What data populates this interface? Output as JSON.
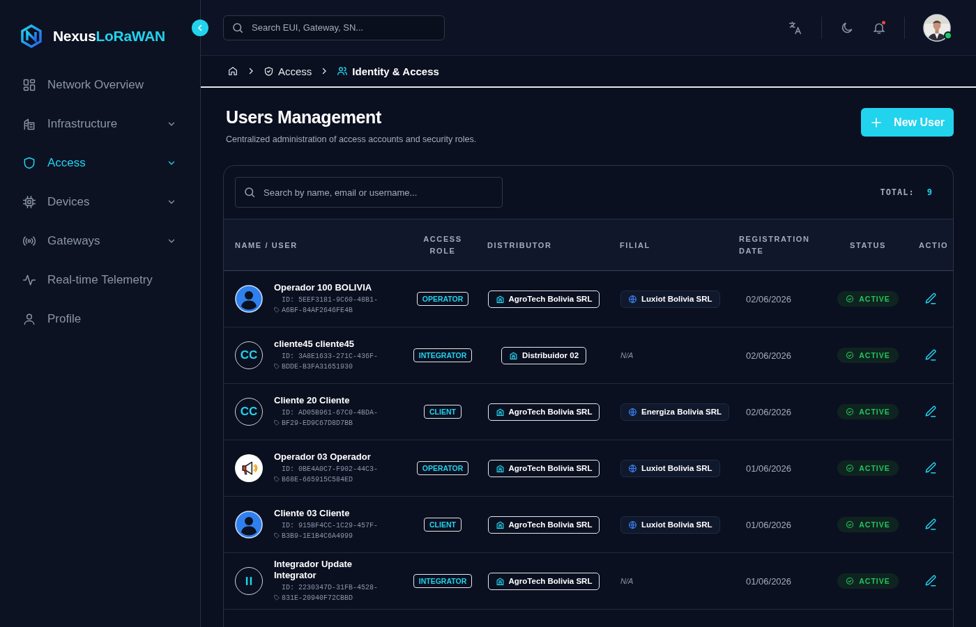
{
  "brand": {
    "name": "Nexus",
    "accent": "LoRaWAN"
  },
  "sidebar": {
    "items": [
      {
        "label": "Network Overview",
        "expandable": false,
        "selected": false
      },
      {
        "label": "Infrastructure",
        "expandable": true,
        "selected": false
      },
      {
        "label": "Access",
        "expandable": true,
        "selected": true
      },
      {
        "label": "Devices",
        "expandable": true,
        "selected": false
      },
      {
        "label": "Gateways",
        "expandable": true,
        "selected": false
      },
      {
        "label": "Real-time Telemetry",
        "expandable": false,
        "selected": false
      },
      {
        "label": "Profile",
        "expandable": false,
        "selected": false
      }
    ]
  },
  "topbar": {
    "search": {
      "placeholder": "Search EUI, Gateway, SN..."
    },
    "notifications_unread": true,
    "user_online": true
  },
  "breadcrumb": [
    {
      "label": "Access",
      "current": false
    },
    {
      "label": "Identity & Access",
      "current": true
    }
  ],
  "page": {
    "title": "Users Management",
    "subtitle": "Centralized administration of access accounts and security roles.",
    "new_button": "New User"
  },
  "table": {
    "search": {
      "placeholder": "Search by name, email or username..."
    },
    "total_label": "TOTAL:",
    "total": "9",
    "columns": [
      "NAME / USER",
      "ACCESS ROLE",
      "DISTRIBUTOR",
      "FILIAL",
      "REGISTRATION DATE",
      "STATUS",
      "ACTIO"
    ],
    "rows": [
      {
        "name": "Operador 100 BOLIVIA",
        "id": "ID: 5EEF3181-9C60-48B1-A6BF-84AF2646FE4B",
        "avatar": {
          "kind": "person"
        },
        "role": "OPERATOR",
        "distributor": "AgroTech Bolivia SRL",
        "filial": {
          "kind": "chip",
          "label": "Luxiot Bolivia SRL"
        },
        "date": "02/06/2026",
        "status": {
          "kind": "active",
          "label": "ACTIVE"
        }
      },
      {
        "name": "cliente45 cliente45",
        "id": "ID: 3A8E1633-271C-436F-BDDE-B3FA31651930",
        "avatar": {
          "kind": "initials",
          "text": "CC"
        },
        "role": "INTEGRATOR",
        "distributor": "Distribuidor 02",
        "filial": {
          "kind": "empty",
          "label": "N/A"
        },
        "date": "02/06/2026",
        "status": {
          "kind": "active",
          "label": "ACTIVE"
        }
      },
      {
        "name": "Cliente 20 Cliente",
        "id": "ID: AD05B961-67C0-4BDA-BF29-ED9C67D8D7BB",
        "avatar": {
          "kind": "initials",
          "text": "CC"
        },
        "role": "CLIENT",
        "distributor": "AgroTech Bolivia SRL",
        "filial": {
          "kind": "chip",
          "label": "Energiza Bolivia SRL"
        },
        "date": "02/06/2026",
        "status": {
          "kind": "active",
          "label": "ACTIVE"
        }
      },
      {
        "name": "Operador 03 Operador",
        "id": "ID: 0BE4A0C7-F902-44C3-B68E-665915C584ED",
        "avatar": {
          "kind": "megaphone"
        },
        "role": "OPERATOR",
        "distributor": "AgroTech Bolivia SRL",
        "filial": {
          "kind": "chip",
          "label": "Luxiot Bolivia SRL"
        },
        "date": "01/06/2026",
        "status": {
          "kind": "active",
          "label": "ACTIVE"
        }
      },
      {
        "name": "Cliente 03 Cliente",
        "id": "ID: 915BF4CC-1C29-457F-B3B9-1E1B4C6A4999",
        "avatar": {
          "kind": "person"
        },
        "role": "CLIENT",
        "distributor": "AgroTech Bolivia SRL",
        "filial": {
          "kind": "chip",
          "label": "Luxiot Bolivia SRL"
        },
        "date": "01/06/2026",
        "status": {
          "kind": "active",
          "label": "ACTIVE"
        }
      },
      {
        "name": "Integrador Update Integrator",
        "id": "ID: 2230347D-31FB-4528-831E-20940F72CBBD",
        "avatar": {
          "kind": "pause"
        },
        "role": "INTEGRATOR",
        "distributor": "AgroTech Bolivia SRL",
        "filial": {
          "kind": "empty",
          "label": "N/A"
        },
        "date": "01/06/2026",
        "status": {
          "kind": "active",
          "label": "ACTIVE"
        }
      }
    ]
  }
}
